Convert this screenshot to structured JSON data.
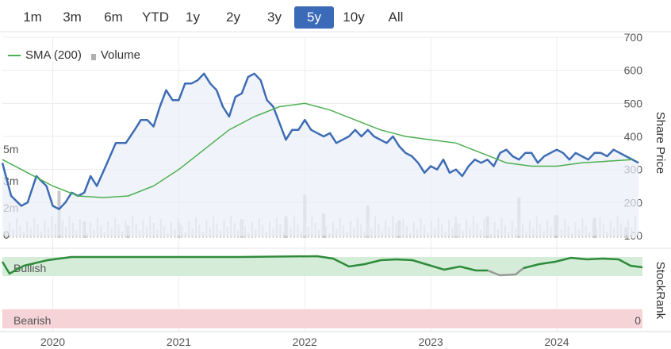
{
  "range_buttons": [
    {
      "label": "1m",
      "active": false
    },
    {
      "label": "3m",
      "active": false
    },
    {
      "label": "6m",
      "active": false
    },
    {
      "label": "YTD",
      "active": false
    },
    {
      "label": "1y",
      "active": false
    },
    {
      "label": "2y",
      "active": false
    },
    {
      "label": "3y",
      "active": false
    },
    {
      "label": "5y",
      "active": true
    },
    {
      "label": "10y",
      "active": false
    },
    {
      "label": "All",
      "active": false
    }
  ],
  "legend": {
    "sma_label": "SMA (200)",
    "volume_label": "Volume"
  },
  "colors": {
    "price": "#3d6cb4",
    "sma": "#4caf50",
    "volume": "#c8c8c8",
    "active_button": "#3b6bb8",
    "bullish_band": "#d4ecd8",
    "bearish_band": "#f5d3d6",
    "stockrank_line": "#2e8b3a",
    "stockrank_low": "#999999"
  },
  "chart_data": [
    {
      "type": "line",
      "ylabel": "Share Price",
      "ylim": [
        100,
        700
      ],
      "y_ticks": [
        "700",
        "600",
        "500",
        "400",
        "300",
        "200",
        "100"
      ],
      "x_ticks": [
        "2020",
        "2021",
        "2022",
        "2023",
        "2024"
      ],
      "volume_ticks": [
        "5m",
        "3m",
        "2m",
        "0"
      ],
      "series": [
        {
          "name": "",
          "x": [
            2019.6,
            2019.67,
            2019.75,
            2019.8,
            2019.87,
            2019.95,
            2020.0,
            2020.05,
            2020.1,
            2020.15,
            2020.2,
            2020.25,
            2020.3,
            2020.35,
            2020.42,
            2020.5,
            2020.58,
            2020.65,
            2020.7,
            2020.75,
            2020.8,
            2020.85,
            2020.9,
            2020.95,
            2021.0,
            2021.05,
            2021.1,
            2021.15,
            2021.2,
            2021.25,
            2021.3,
            2021.35,
            2021.4,
            2021.45,
            2021.5,
            2021.55,
            2021.6,
            2021.65,
            2021.7,
            2021.75,
            2021.8,
            2021.85,
            2021.9,
            2021.95,
            2022.0,
            2022.05,
            2022.1,
            2022.15,
            2022.2,
            2022.25,
            2022.3,
            2022.35,
            2022.4,
            2022.45,
            2022.5,
            2022.55,
            2022.6,
            2022.65,
            2022.7,
            2022.75,
            2022.8,
            2022.85,
            2022.9,
            2022.95,
            2023.0,
            2023.05,
            2023.1,
            2023.15,
            2023.2,
            2023.25,
            2023.3,
            2023.35,
            2023.4,
            2023.45,
            2023.5,
            2023.55,
            2023.6,
            2023.65,
            2023.7,
            2023.75,
            2023.8,
            2023.85,
            2023.9,
            2023.95,
            2024.0,
            2024.05,
            2024.1,
            2024.15,
            2024.2,
            2024.25,
            2024.3,
            2024.35,
            2024.4,
            2024.45,
            2024.5,
            2024.55,
            2024.6,
            2024.65
          ],
          "values": [
            320,
            220,
            190,
            200,
            280,
            250,
            190,
            180,
            200,
            230,
            220,
            230,
            280,
            250,
            310,
            380,
            380,
            420,
            450,
            450,
            430,
            490,
            540,
            510,
            510,
            560,
            560,
            570,
            590,
            560,
            540,
            490,
            460,
            520,
            530,
            580,
            590,
            570,
            510,
            490,
            440,
            390,
            420,
            420,
            450,
            420,
            410,
            400,
            410,
            380,
            390,
            400,
            420,
            400,
            420,
            400,
            390,
            380,
            400,
            370,
            350,
            340,
            320,
            290,
            310,
            300,
            330,
            290,
            300,
            280,
            310,
            330,
            320,
            330,
            310,
            350,
            360,
            340,
            330,
            350,
            350,
            320,
            340,
            350,
            360,
            350,
            330,
            350,
            340,
            330,
            350,
            350,
            340,
            360,
            350,
            340,
            330,
            320
          ],
          "note_x_units": "year"
        },
        {
          "name": "SMA (200)",
          "x": [
            2019.6,
            2019.8,
            2020.0,
            2020.2,
            2020.4,
            2020.6,
            2020.8,
            2021.0,
            2021.2,
            2021.4,
            2021.6,
            2021.8,
            2022.0,
            2022.2,
            2022.4,
            2022.6,
            2022.8,
            2023.0,
            2023.2,
            2023.4,
            2023.6,
            2023.8,
            2024.0,
            2024.2,
            2024.4,
            2024.6
          ],
          "values": [
            330,
            290,
            250,
            220,
            215,
            220,
            250,
            300,
            360,
            420,
            460,
            490,
            500,
            480,
            450,
            420,
            400,
            390,
            380,
            350,
            320,
            310,
            310,
            320,
            325,
            330
          ]
        }
      ],
      "volume": [
        {
          "x": 2020.05,
          "value": 3.5
        },
        {
          "x": 2020.25,
          "value": 1.2
        },
        {
          "x": 2020.6,
          "value": 0.9
        },
        {
          "x": 2021.0,
          "value": 1.1
        },
        {
          "x": 2021.5,
          "value": 1.4
        },
        {
          "x": 2021.85,
          "value": 1.6
        },
        {
          "x": 2022.0,
          "value": 3.2
        },
        {
          "x": 2022.15,
          "value": 1.8
        },
        {
          "x": 2022.5,
          "value": 2.4
        },
        {
          "x": 2022.75,
          "value": 1.3
        },
        {
          "x": 2023.2,
          "value": 1.1
        },
        {
          "x": 2023.45,
          "value": 1.6
        },
        {
          "x": 2023.7,
          "value": 3.0
        },
        {
          "x": 2024.0,
          "value": 1.7
        },
        {
          "x": 2024.3,
          "value": 1.5
        },
        {
          "x": 2024.55,
          "value": 0.8
        }
      ]
    },
    {
      "type": "line",
      "ylabel": "StockRank",
      "band_labels": {
        "bullish": "Bullish",
        "bearish": "Bearish"
      },
      "bottom_value_label": "0"
    }
  ]
}
